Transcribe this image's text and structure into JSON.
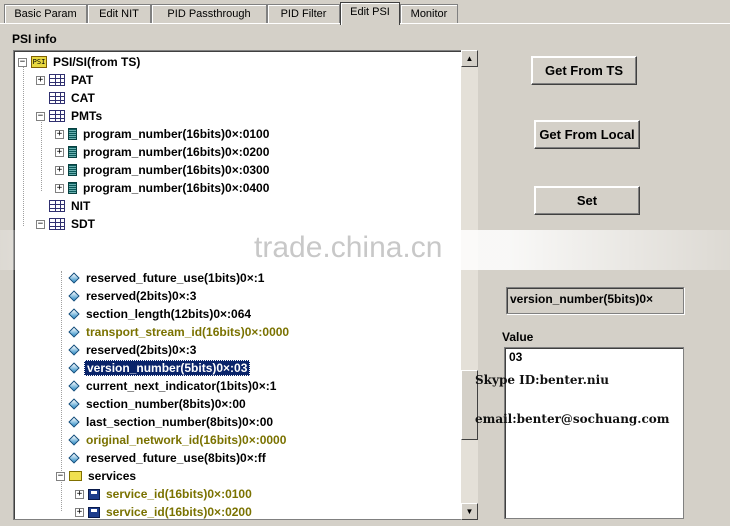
{
  "tabs": [
    {
      "label": "Basic Param",
      "active": false
    },
    {
      "label": "Edit NIT",
      "active": false
    },
    {
      "label": "PID Passthrough",
      "active": false
    },
    {
      "label": "PID Filter",
      "active": false
    },
    {
      "label": "Edit PSI",
      "active": true
    },
    {
      "label": "Monitor",
      "active": false
    }
  ],
  "psi_group_title": "PSI info",
  "tree": {
    "root": "PSI/SI(from TS)",
    "pat": "PAT",
    "cat": "CAT",
    "pmts": "PMTs",
    "programs": [
      "program_number(16bits)0×:0100",
      "program_number(16bits)0×:0200",
      "program_number(16bits)0×:0300",
      "program_number(16bits)0×:0400"
    ],
    "nit": "NIT",
    "sdt": "SDT",
    "sdt_fields": [
      "reserved_future_use(1bits)0×:1",
      "reserved(2bits)0×:3",
      "section_length(12bits)0×:064",
      "transport_stream_id(16bits)0×:0000",
      "reserved(2bits)0×:3",
      "version_number(5bits)0×:03",
      "current_next_indicator(1bits)0×:1",
      "section_number(8bits)0×:00",
      "last_section_number(8bits)0×:00",
      "original_network_id(16bits)0×:0000",
      "reserved_future_use(8bits)0×:ff"
    ],
    "services": "services",
    "service_ids": [
      "service_id(16bits)0×:0100",
      "service_id(16bits)0×:0200"
    ]
  },
  "buttons": {
    "get_from_ts": "Get From TS",
    "get_from_local": "Get From Local",
    "set": "Set"
  },
  "selected_field": "version_number(5bits)0×",
  "value_label": "Value",
  "value_text": "03",
  "overlay": {
    "skype": "Skype ID:benter.niu",
    "email": "email:benter@sochuang.com",
    "watermark": "trade.china.cn"
  },
  "colors": {
    "selection": "#0a246a",
    "olive_text": "#7a7200",
    "window_bg": "#d4d0c8"
  }
}
